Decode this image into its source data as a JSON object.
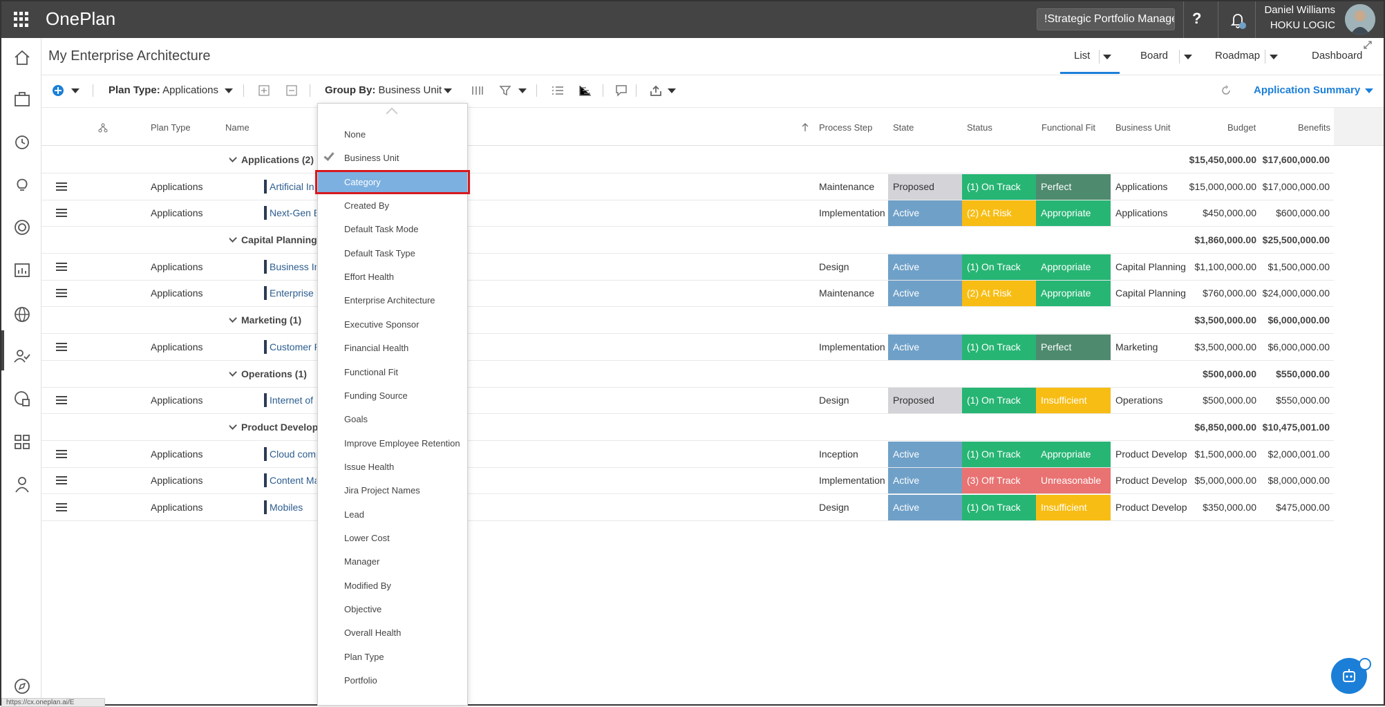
{
  "topbar": {
    "app_name": "OnePlan",
    "portfolio": "!Strategic Portfolio Manager",
    "help": "?",
    "user_name": "Daniel Williams",
    "user_org": "HOKU LOGIC"
  },
  "page": {
    "title": "My Enterprise Architecture",
    "views": [
      "List",
      "Board",
      "Roadmap",
      "Dashboard"
    ]
  },
  "toolbar": {
    "plan_type_label": "Plan Type:",
    "plan_type_value": "Applications",
    "group_by_label": "Group By:",
    "group_by_value": "Business Unit",
    "summary": "Application Summary"
  },
  "columns": {
    "plan_type": "Plan Type",
    "name": "Name",
    "process_step": "Process Step",
    "state": "State",
    "status": "Status",
    "functional_fit": "Functional Fit",
    "business_unit": "Business Unit",
    "budget": "Budget",
    "benefits": "Benefits"
  },
  "groups": [
    {
      "label": "Applications (2)",
      "budget": "$15,450,000.00",
      "benefits": "$17,600,000.00"
    },
    {
      "label": "Capital Planning",
      "budget": "$1,860,000.00",
      "benefits": "$25,500,000.00"
    },
    {
      "label": "Marketing (1)",
      "budget": "$3,500,000.00",
      "benefits": "$6,000,000.00"
    },
    {
      "label": "Operations (1)",
      "budget": "$500,000.00",
      "benefits": "$550,000.00"
    },
    {
      "label": "Product Develop",
      "budget": "$6,850,000.00",
      "benefits": "$10,475,001.00"
    }
  ],
  "rows": [
    {
      "plan_type": "Applications",
      "name": "Artificial In",
      "process_step": "Maintenance",
      "state": "Proposed",
      "status": "(1) On Track",
      "fit": "Perfect",
      "unit": "Applications",
      "budget": "$15,000,000.00",
      "benefits": "$17,000,000.00"
    },
    {
      "plan_type": "Applications",
      "name": "Next-Gen E",
      "process_step": "Implementation",
      "state": "Active",
      "status": "(2) At Risk",
      "fit": "Appropriate",
      "unit": "Applications",
      "budget": "$450,000.00",
      "benefits": "$600,000.00"
    },
    {
      "plan_type": "Applications",
      "name": "Business In",
      "process_step": "Design",
      "state": "Active",
      "status": "(1) On Track",
      "fit": "Appropriate",
      "unit": "Capital Planning",
      "budget": "$1,100,000.00",
      "benefits": "$1,500,000.00"
    },
    {
      "plan_type": "Applications",
      "name": "Enterprise F",
      "process_step": "Maintenance",
      "state": "Active",
      "status": "(2) At Risk",
      "fit": "Appropriate",
      "unit": "Capital Planning",
      "budget": "$760,000.00",
      "benefits": "$24,000,000.00"
    },
    {
      "plan_type": "Applications",
      "name": "Customer F",
      "process_step": "Implementation",
      "state": "Active",
      "status": "(1) On Track",
      "fit": "Perfect",
      "unit": "Marketing",
      "budget": "$3,500,000.00",
      "benefits": "$6,000,000.00"
    },
    {
      "plan_type": "Applications",
      "name": "Internet of",
      "process_step": "Design",
      "state": "Proposed",
      "status": "(1) On Track",
      "fit": "Insufficient",
      "unit": "Operations",
      "budget": "$500,000.00",
      "benefits": "$550,000.00"
    },
    {
      "plan_type": "Applications",
      "name": "Cloud comp",
      "process_step": "Inception",
      "state": "Active",
      "status": "(1) On Track",
      "fit": "Appropriate",
      "unit": "Product Develop",
      "budget": "$1,500,000.00",
      "benefits": "$2,000,001.00"
    },
    {
      "plan_type": "Applications",
      "name": "Content Ma",
      "process_step": "Implementation",
      "state": "Active",
      "status": "(3) Off Track",
      "fit": "Unreasonable",
      "unit": "Product Develop",
      "budget": "$5,000,000.00",
      "benefits": "$8,000,000.00"
    },
    {
      "plan_type": "Applications",
      "name": "Mobiles",
      "process_step": "Design",
      "state": "Active",
      "status": "(1) On Track",
      "fit": "Insufficient",
      "unit": "Product Develop",
      "budget": "$350,000.00",
      "benefits": "$475,000.00"
    }
  ],
  "group_by_menu": {
    "options": [
      "None",
      "Business Unit",
      "Category",
      "Created By",
      "Default Task Mode",
      "Default Task Type",
      "Effort Health",
      "Enterprise Architecture",
      "Executive Sponsor",
      "Financial Health",
      "Functional Fit",
      "Funding Source",
      "Goals",
      "Improve Employee Retention",
      "Issue Health",
      "Jira Project Names",
      "Lead",
      "Lower Cost",
      "Manager",
      "Modified By",
      "Objective",
      "Overall Health",
      "Plan Type",
      "Portfolio"
    ],
    "checked": "Business Unit",
    "hovered": "Category"
  },
  "colors": {
    "proposed": "#d3d3d8",
    "active": "#6fa0c8",
    "on_track": "#27b574",
    "at_risk": "#f8bd14",
    "off_track": "#e97272",
    "perfect": "#4e8a6e",
    "appropriate": "#27b574",
    "insufficient": "#f8bd14",
    "unreasonable": "#e97272",
    "accent": "#1b7fd8"
  },
  "status_url": "https://cx.oneplan.ai/E"
}
